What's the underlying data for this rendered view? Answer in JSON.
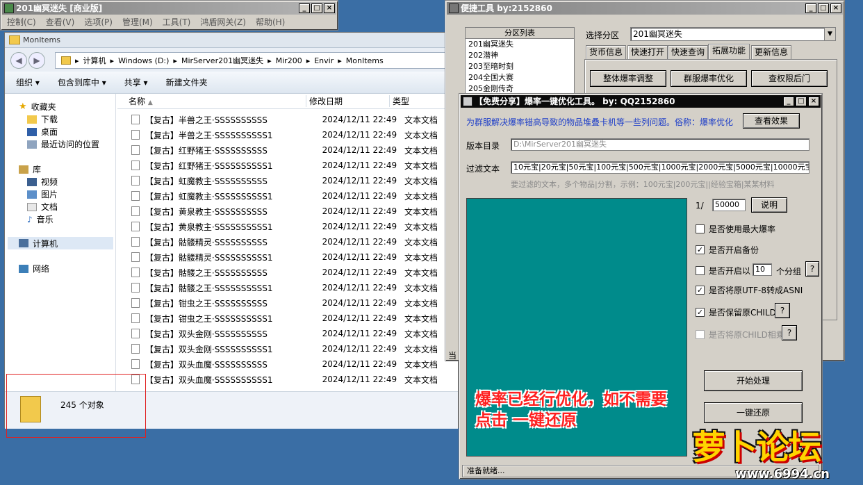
{
  "back_window": {
    "title": "201幽冥迷失 [商业版]",
    "menu": [
      "控制(C)",
      "查看(V)",
      "选项(P)",
      "管理(M)",
      "工具(T)",
      "鸿盾网关(Z)",
      "帮助(H)"
    ]
  },
  "explorer": {
    "title": "MonItems",
    "address": [
      "计算机",
      "Windows (D:)",
      "MirServer201幽冥迷失",
      "Mir200",
      "Envir",
      "MonItems"
    ],
    "toolbar": [
      "组织",
      "包含到库中",
      "共享",
      "新建文件夹"
    ],
    "sidebar": {
      "favorites_label": "收藏夹",
      "favorites": [
        "下载",
        "桌面",
        "最近访问的位置"
      ],
      "library_label": "库",
      "library": [
        "视频",
        "图片",
        "文档",
        "音乐"
      ],
      "computer": "计算机",
      "network": "网络"
    },
    "columns": [
      "名称",
      "修改日期",
      "类型"
    ],
    "files": [
      {
        "name": "【复古】半兽之王·SSSSSSSSSS",
        "date": "2024/12/11 22:49",
        "type": "文本文档"
      },
      {
        "name": "【复古】半兽之王·SSSSSSSSSS1",
        "date": "2024/12/11 22:49",
        "type": "文本文档"
      },
      {
        "name": "【复古】红野猪王·SSSSSSSSSS",
        "date": "2024/12/11 22:49",
        "type": "文本文档"
      },
      {
        "name": "【复古】红野猪王·SSSSSSSSSS1",
        "date": "2024/12/11 22:49",
        "type": "文本文档"
      },
      {
        "name": "【复古】虹魔教主·SSSSSSSSSS",
        "date": "2024/12/11 22:49",
        "type": "文本文档"
      },
      {
        "name": "【复古】虹魔教主·SSSSSSSSSS1",
        "date": "2024/12/11 22:49",
        "type": "文本文档"
      },
      {
        "name": "【复古】黄泉教主·SSSSSSSSSS",
        "date": "2024/12/11 22:49",
        "type": "文本文档"
      },
      {
        "name": "【复古】黄泉教主·SSSSSSSSSS1",
        "date": "2024/12/11 22:49",
        "type": "文本文档"
      },
      {
        "name": "【复古】骷髅精灵·SSSSSSSSSS",
        "date": "2024/12/11 22:49",
        "type": "文本文档"
      },
      {
        "name": "【复古】骷髅精灵·SSSSSSSSSS1",
        "date": "2024/12/11 22:49",
        "type": "文本文档"
      },
      {
        "name": "【复古】骷髅之王·SSSSSSSSSS",
        "date": "2024/12/11 22:49",
        "type": "文本文档"
      },
      {
        "name": "【复古】骷髅之王·SSSSSSSSSS1",
        "date": "2024/12/11 22:49",
        "type": "文本文档"
      },
      {
        "name": "【复古】钳虫之王·SSSSSSSSSS",
        "date": "2024/12/11 22:49",
        "type": "文本文档"
      },
      {
        "name": "【复古】钳虫之王·SSSSSSSSSS1",
        "date": "2024/12/11 22:49",
        "type": "文本文档"
      },
      {
        "name": "【复古】双头金刚·SSSSSSSSSS",
        "date": "2024/12/11 22:49",
        "type": "文本文档"
      },
      {
        "name": "【复古】双头金刚·SSSSSSSSSS1",
        "date": "2024/12/11 22:49",
        "type": "文本文档"
      },
      {
        "name": "【复古】双头血魔·SSSSSSSSSS",
        "date": "2024/12/11 22:49",
        "type": "文本文档"
      },
      {
        "name": "【复古】双头血魔·SSSSSSSSSS1",
        "date": "2024/12/11 22:49",
        "type": "文本文档"
      }
    ],
    "status_count": "245 个对象"
  },
  "quick_tool": {
    "title": "便捷工具  by:2152860",
    "partition_list_label": "分区列表",
    "partitions": [
      "201幽冥迷失",
      "202潜神",
      "203至暗时刻",
      "204全国大赛",
      "205金刚传奇"
    ],
    "select_label": "选择分区",
    "select_value": "201幽冥迷失",
    "tabs": [
      "货币信息",
      "快速打开",
      "快速查询",
      "拓展功能",
      "更新信息"
    ],
    "buttons": [
      "整体爆率调整",
      "群服爆率优化",
      "查权限后门"
    ],
    "cut_label": "当"
  },
  "optimizer": {
    "title": "【免费分享】爆率一键优化工具。  by: QQ2152860",
    "description": "为群服解决爆率错高导致的物品堆叠卡机等一些列问题。俗称：爆率优化",
    "view_effect": "查看效果",
    "version_dir_label": "版本目录",
    "version_dir": "D:\\MirServer201幽冥迷失",
    "filter_label": "过滤文本",
    "filter_value": "10元宝|20元宝|50元宝|100元宝|500元宝|1000元宝|2000元宝|5000元宝|10000元宝",
    "filter_hint": "要过滤的文本，多个物品|分割，示例：100元宝|200元宝||经验宝箱|某某材料",
    "ratio_prefix": "1/",
    "ratio_value": "50000",
    "explain_btn": "说明",
    "options": {
      "max_rate": "是否使用最大爆率",
      "backup": "是否开启备份",
      "group_prefix": "是否开启以",
      "group_value": "10",
      "group_suffix": "个分组",
      "utf8": "是否将原UTF-8转成ASNI",
      "keep_child": "是否保留原CHILD",
      "child_mul": "是否将原CHILD相乘"
    },
    "help_q": "?",
    "start_btn": "开始处理",
    "restore_btn": "一键还原",
    "status": "准备就绪...",
    "overlay": "爆率已经行优化，如不需要\n点击 一键还原",
    "colors": {
      "panel": "#008b8b",
      "overlay": "#ff1f1f",
      "desc": "#1f3fc8"
    }
  },
  "watermark": {
    "logo": "萝卜论坛",
    "url": "www.6994.cn"
  }
}
